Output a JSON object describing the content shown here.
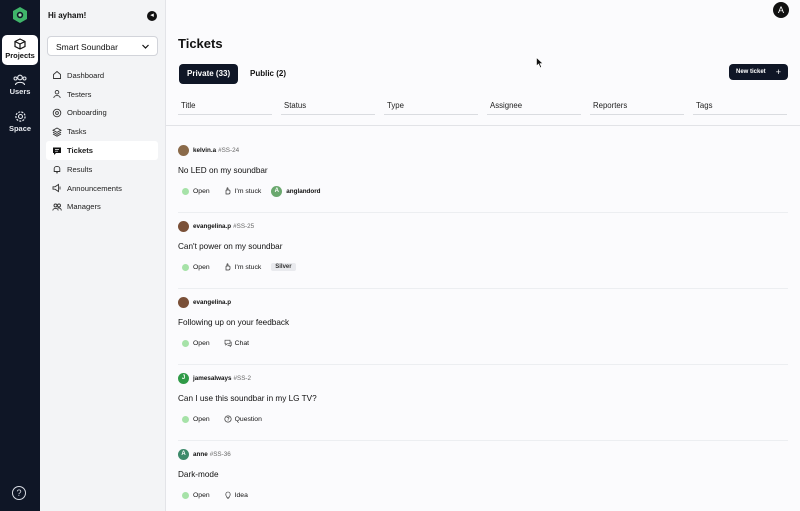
{
  "rail": {
    "items": [
      {
        "label": "Projects",
        "icon": "box-icon",
        "active": true
      },
      {
        "label": "Users",
        "icon": "users-icon",
        "active": false
      },
      {
        "label": "Space",
        "icon": "gear-icon",
        "active": false
      }
    ],
    "help_glyph": "?"
  },
  "sidenav": {
    "greeting": "Hi ayham!",
    "collapse_glyph": "◂",
    "project": "Smart Soundbar",
    "items": [
      {
        "label": "Dashboard",
        "icon": "house-icon"
      },
      {
        "label": "Testers",
        "icon": "person-icon"
      },
      {
        "label": "Onboarding",
        "icon": "flower-icon"
      },
      {
        "label": "Tasks",
        "icon": "layers-icon"
      },
      {
        "label": "Tickets",
        "icon": "chat-icon",
        "active": true
      },
      {
        "label": "Results",
        "icon": "bell-icon"
      },
      {
        "label": "Announcements",
        "icon": "speaker-icon"
      },
      {
        "label": "Managers",
        "icon": "people-icon"
      }
    ]
  },
  "header": {
    "user_initial": "A",
    "title": "Tickets",
    "tabs": [
      {
        "label": "Private (33)",
        "active": true
      },
      {
        "label": "Public (2)",
        "active": false
      }
    ],
    "new_ticket_label": "New ticket",
    "new_ticket_glyph": "+"
  },
  "columns": [
    "Title",
    "Status",
    "Type",
    "Assignee",
    "Reporters",
    "Tags"
  ],
  "tickets": [
    {
      "user": "kelvin.a",
      "id": "#SS-24",
      "title": "No LED on my soundbar",
      "status": "Open",
      "type": "I'm stuck",
      "type_icon": "hand-icon",
      "assignee_initial": "A",
      "assignee": "anglandord",
      "tag": "",
      "avatar_color": "#8a6a4a"
    },
    {
      "user": "evangelina.p",
      "id": "#SS-25",
      "title": "Can't power on my soundbar",
      "status": "Open",
      "type": "I'm stuck",
      "type_icon": "hand-icon",
      "assignee_initial": "",
      "assignee": "",
      "tag": "Silver",
      "avatar_color": "#7a5038"
    },
    {
      "user": "evangelina.p",
      "id": "",
      "title": "Following up on your feedback",
      "status": "Open",
      "type": "Chat",
      "type_icon": "chat-bubble-icon",
      "assignee_initial": "",
      "assignee": "",
      "tag": "",
      "avatar_color": "#7a5038"
    },
    {
      "user": "jamesalways",
      "id": "#SS-2",
      "title": "Can I use this soundbar in my LG TV?",
      "status": "Open",
      "type": "Question",
      "type_icon": "question-circle-icon",
      "assignee_initial": "",
      "assignee": "",
      "tag": "",
      "avatar_initial": "J",
      "avatar_color": "#2f9a47"
    },
    {
      "user": "anne",
      "id": "#SS-36",
      "title": "Dark-mode",
      "status": "Open",
      "type": "Idea",
      "type_icon": "lightbulb-icon",
      "assignee_initial": "",
      "assignee": "",
      "tag": "",
      "avatar_initial": "A",
      "avatar_color": "#3d8a6a"
    }
  ]
}
